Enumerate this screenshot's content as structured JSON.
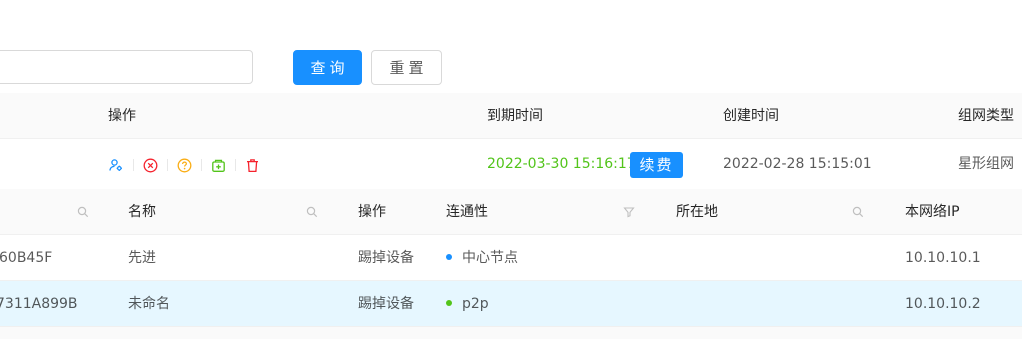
{
  "search": {
    "query_label": "查询",
    "reset_label": "重置"
  },
  "outer_table": {
    "headers": {
      "operations": "操作",
      "expiry": "到期时间",
      "created": "创建时间",
      "network_type": "组网类型"
    },
    "row": {
      "expiry_time": "2022-03-30 15:16:17",
      "renew_label": "续费",
      "created_time": "2022-02-28 15:15:01",
      "network_type": "星形组网"
    },
    "operation_icons": [
      "user-settings-icon",
      "close-circle-icon",
      "question-circle-icon",
      "add-box-icon",
      "delete-icon"
    ]
  },
  "inner_table": {
    "headers": {
      "name": "名称",
      "operations": "操作",
      "connectivity": "连通性",
      "location": "所在地",
      "network_ip": "本网络IP"
    },
    "rows": [
      {
        "id": "60B45F",
        "name": "先进",
        "action": "踢掉设备",
        "connectivity": "中心节点",
        "status_color": "#1890ff",
        "location": "",
        "ip": "10.10.10.1"
      },
      {
        "id": "7311A899B",
        "name": "未命名",
        "action": "踢掉设备",
        "connectivity": "p2p",
        "status_color": "#52c41a",
        "location": "",
        "ip": "10.10.10.2"
      }
    ]
  },
  "colors": {
    "primary": "#1890ff",
    "success": "#52c41a",
    "warning": "#faad14",
    "danger": "#f5222d",
    "selected_row_bg": "#e6f7ff"
  }
}
